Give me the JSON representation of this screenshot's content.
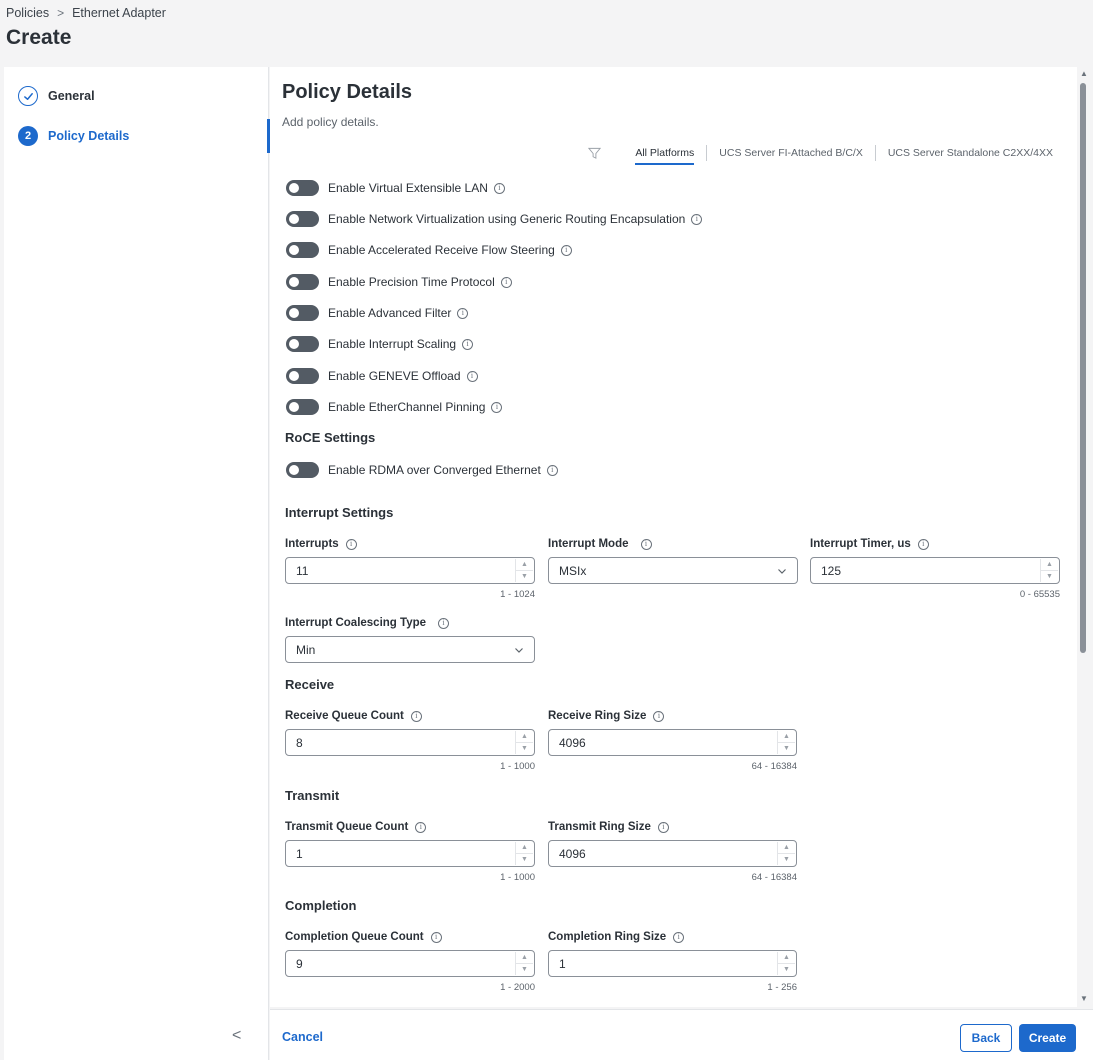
{
  "breadcrumb": {
    "items": [
      "Policies",
      "Ethernet Adapter"
    ],
    "separator": ">"
  },
  "page_title": "Create",
  "wizard": {
    "steps": [
      {
        "label": "General",
        "state": "completed",
        "icon": "check-icon"
      },
      {
        "number": "2",
        "label": "Policy Details",
        "state": "active"
      }
    ],
    "collapse_glyph": "<"
  },
  "content": {
    "title": "Policy Details",
    "subtitle": "Add policy details.",
    "platform_tabs": [
      "All Platforms",
      "UCS Server FI-Attached B/C/X",
      "UCS Server Standalone C2XX/4XX"
    ],
    "toggles": [
      {
        "label": "Enable Virtual Extensible LAN",
        "enabled": false
      },
      {
        "label": "Enable Network Virtualization using Generic Routing Encapsulation",
        "enabled": false
      },
      {
        "label": "Enable Accelerated Receive Flow Steering",
        "enabled": false
      },
      {
        "label": "Enable Precision Time Protocol",
        "enabled": false
      },
      {
        "label": "Enable Advanced Filter",
        "enabled": false
      },
      {
        "label": "Enable Interrupt Scaling",
        "enabled": false
      },
      {
        "label": "Enable GENEVE Offload",
        "enabled": false
      },
      {
        "label": "Enable EtherChannel Pinning",
        "enabled": false
      }
    ],
    "roce": {
      "title": "RoCE Settings",
      "toggle": {
        "label": "Enable RDMA over Converged Ethernet",
        "enabled": false
      }
    },
    "interrupt": {
      "title": "Interrupt Settings",
      "interrupts": {
        "label": "Interrupts",
        "value": "11",
        "range": "1 - 1024"
      },
      "mode": {
        "label": "Interrupt Mode",
        "value": "MSIx"
      },
      "timer": {
        "label": "Interrupt Timer, us",
        "value": "125",
        "range": "0 - 65535"
      },
      "coalescing": {
        "label": "Interrupt Coalescing Type",
        "value": "Min"
      }
    },
    "receive": {
      "title": "Receive",
      "queue_count": {
        "label": "Receive Queue Count",
        "value": "8",
        "range": "1 - 1000"
      },
      "ring_size": {
        "label": "Receive Ring Size",
        "value": "4096",
        "range": "64 - 16384"
      }
    },
    "transmit": {
      "title": "Transmit",
      "queue_count": {
        "label": "Transmit Queue Count",
        "value": "1",
        "range": "1 - 1000"
      },
      "ring_size": {
        "label": "Transmit Ring Size",
        "value": "4096",
        "range": "64 - 16384"
      }
    },
    "completion": {
      "title": "Completion",
      "queue_count": {
        "label": "Completion Queue Count",
        "value": "9",
        "range": "1 - 2000"
      },
      "ring_size": {
        "label": "Completion Ring Size",
        "value": "1",
        "range": "1 - 256"
      }
    }
  },
  "footer": {
    "cancel": "Cancel",
    "back": "Back",
    "create": "Create"
  },
  "colors": {
    "primary": "#1d69cc",
    "toggle_off": "#535b64",
    "text": "#2b3138",
    "background": "#f4f4f5"
  }
}
